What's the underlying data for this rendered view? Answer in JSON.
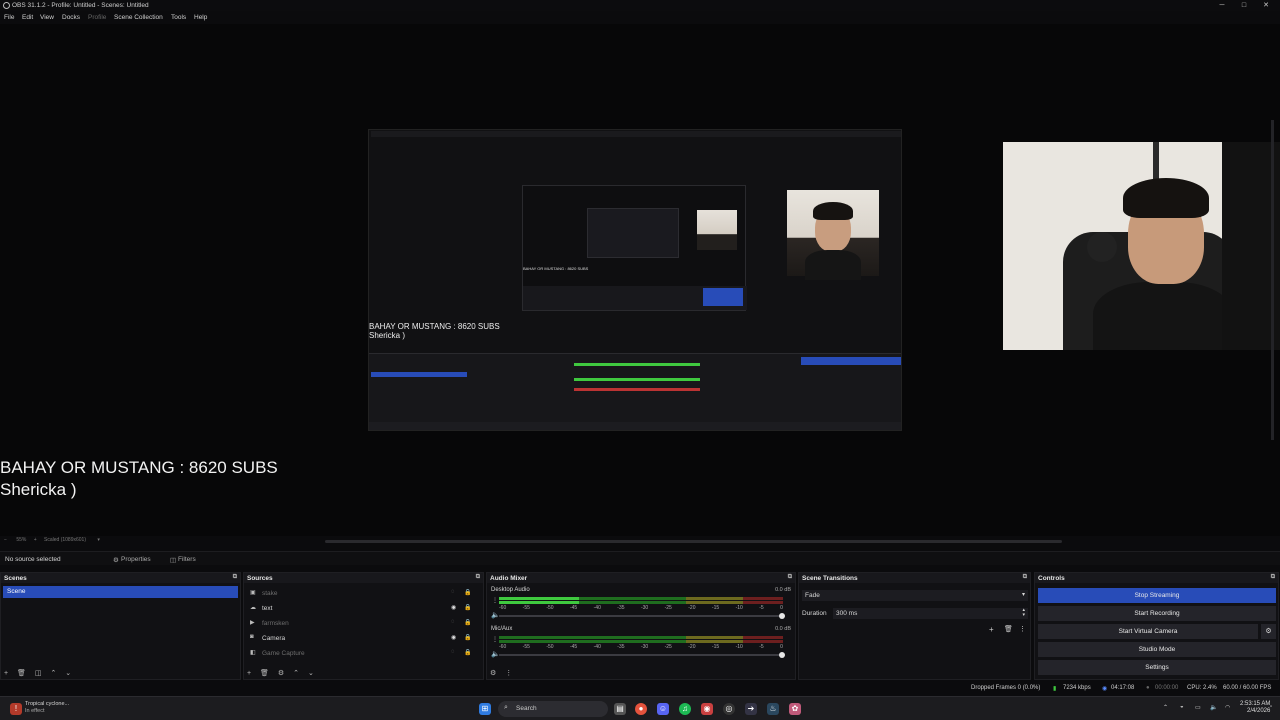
{
  "window": {
    "title": "OBS 31.1.2 - Profile: Untitled - Scenes: Untitled",
    "minimize": "─",
    "maximize": "□",
    "close": "✕"
  },
  "menu": [
    "File",
    "Edit",
    "View",
    "Docks",
    "Profile",
    "Scene Collection",
    "Tools",
    "Help"
  ],
  "preview": {
    "overlay_line1": "BAHAY OR MUSTANG : 8620 SUBS",
    "overlay_line2": "Shericka )",
    "capture_text_line1": "BAHAY OR MUSTANG : 8620 SUBS",
    "capture_text_line2": "Shericka )",
    "zoom": "55%",
    "scale_label": "Scaled (1089x601)"
  },
  "source_bar": {
    "status": "No source selected",
    "properties": "Properties",
    "filters": "Filters"
  },
  "scenes": {
    "header": "Scenes",
    "items": [
      "Scene"
    ]
  },
  "sources": {
    "header": "Sources",
    "items": [
      {
        "name": "stake",
        "icon": "image",
        "visible": false
      },
      {
        "name": "text",
        "icon": "text",
        "visible": true
      },
      {
        "name": "farmsken",
        "icon": "media",
        "visible": false
      },
      {
        "name": "Camera",
        "icon": "camera",
        "visible": true
      },
      {
        "name": "Game Capture",
        "icon": "game",
        "visible": false
      }
    ]
  },
  "audio_mixer": {
    "header": "Audio Mixer",
    "channels": [
      {
        "name": "Desktop Audio",
        "db": "0.0 dB",
        "level": 0.28
      },
      {
        "name": "Mic/Aux",
        "db": "0.0 dB",
        "level": 0.0
      }
    ],
    "ticks": [
      "-60",
      "-55",
      "-50",
      "-45",
      "-40",
      "-35",
      "-30",
      "-25",
      "-20",
      "-15",
      "-10",
      "-5",
      "0"
    ]
  },
  "transitions": {
    "header": "Scene Transitions",
    "selected": "Fade",
    "duration_label": "Duration",
    "duration_value": "300 ms"
  },
  "controls": {
    "header": "Controls",
    "buttons": [
      "Stop Streaming",
      "Start Recording",
      "Start Virtual Camera",
      "Studio Mode",
      "Settings"
    ]
  },
  "status": {
    "dropped": "Dropped Frames 0 (0.0%)",
    "bitrate": "7234 kbps",
    "stream_time": "04:17:08",
    "rec_time": "00:00:00",
    "cpu": "CPU: 2.4%",
    "fps": "60.00 / 60.00 FPS"
  },
  "taskbar": {
    "weather_line1": "Tropical cyclone...",
    "weather_line2": "In effect",
    "search": "Search",
    "time": "2:53:15 AM",
    "date": "2/4/2026"
  },
  "colors": {
    "accent": "#284cb8",
    "background": "#0b0b0d"
  }
}
